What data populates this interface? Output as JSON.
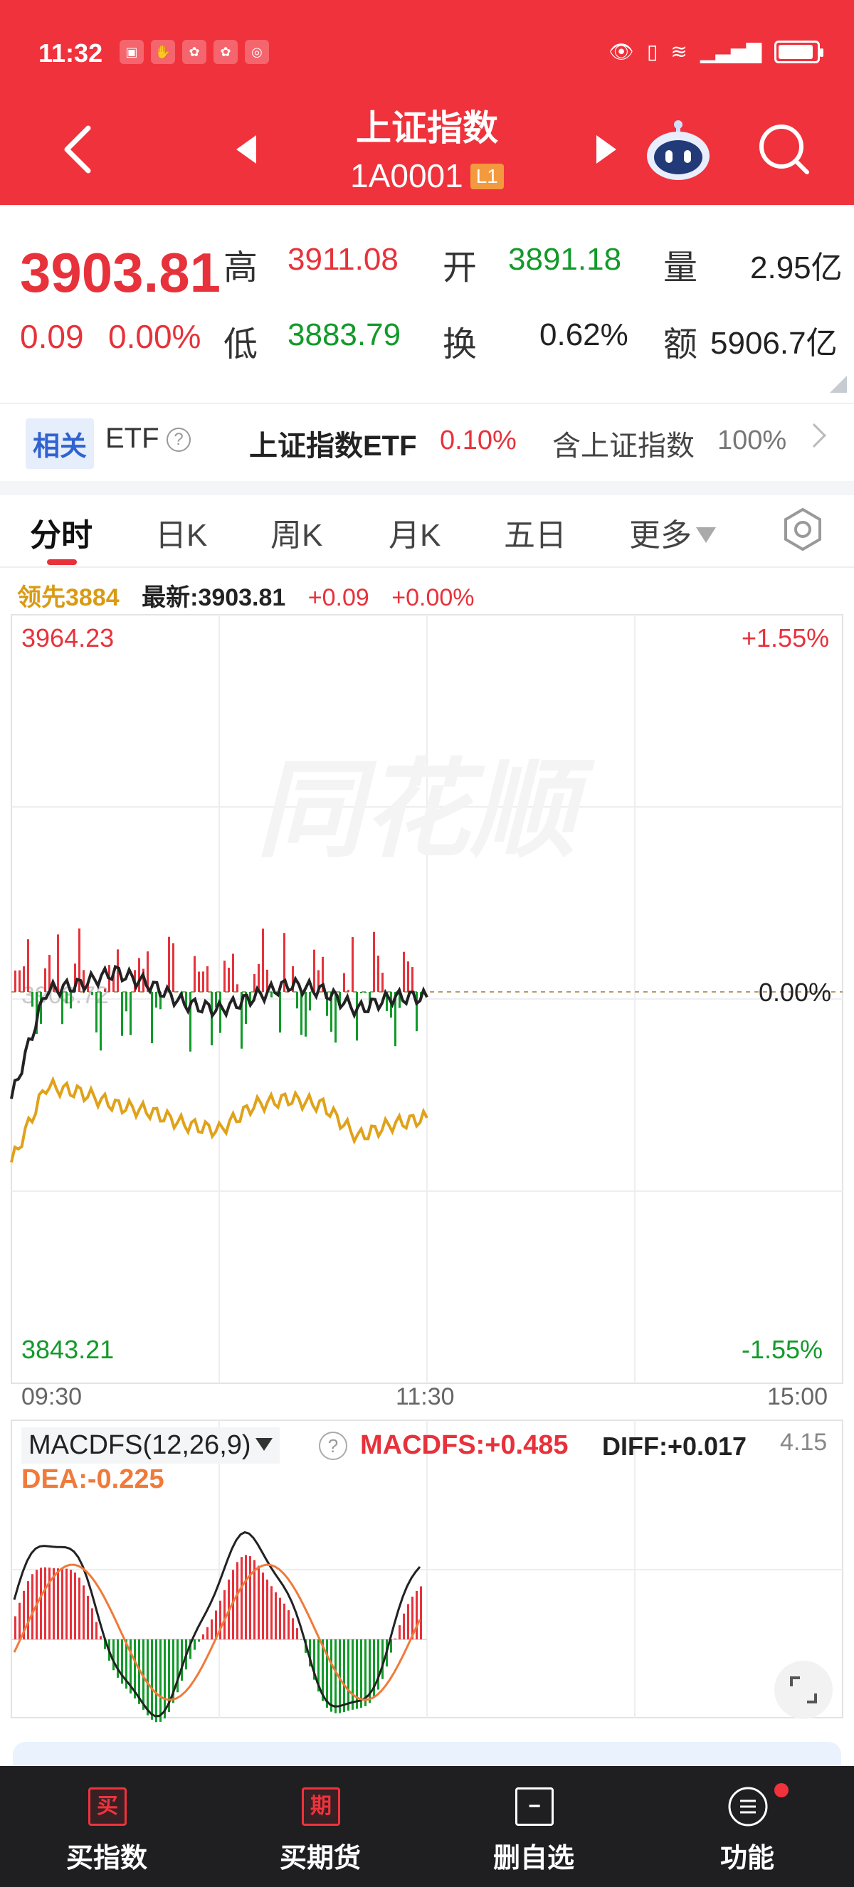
{
  "status_bar": {
    "time": "11:32"
  },
  "header": {
    "title": "上证指数",
    "code": "1A0001",
    "badge": "L1"
  },
  "quote": {
    "price": "3903.81",
    "change_abs": "0.09",
    "change_pct": "0.00%",
    "high_label": "高",
    "high": "3911.08",
    "low_label": "低",
    "low": "3883.79",
    "open_label": "开",
    "open": "3891.18",
    "turnover_label": "换",
    "turnover": "0.62%",
    "volume_label": "量",
    "volume": "2.95亿",
    "amount_label": "额",
    "amount": "5906.7亿"
  },
  "etf": {
    "tag": "相关",
    "label": "ETF",
    "help": "?",
    "name": "上证指数ETF",
    "pct": "0.10%",
    "contains_label": "含上证指数",
    "weight": "100%"
  },
  "tabs": [
    {
      "label": "分时"
    },
    {
      "label": "日K"
    },
    {
      "label": "周K"
    },
    {
      "label": "月K"
    },
    {
      "label": "五日"
    },
    {
      "label": "更多"
    }
  ],
  "info": {
    "lead_label": "领先3884",
    "latest": "最新:3903.81",
    "change_abs": "+0.09",
    "change_pct": "+0.00%"
  },
  "chart": {
    "y_max": "3964.23",
    "y_min": "3843.21",
    "pct_max": "+1.55%",
    "pct_mid": "0.00%",
    "pct_min": "-1.55%",
    "prev_close_faint": "3903.72",
    "watermark": "同花顺",
    "times": [
      "09:30",
      "11:30",
      "15:00"
    ]
  },
  "chart_data": {
    "type": "line",
    "x": [
      "09:30",
      "09:40",
      "09:50",
      "10:00",
      "10:10",
      "10:20",
      "10:30",
      "10:40",
      "10:50",
      "11:00",
      "11:10",
      "11:20",
      "11:30"
    ],
    "series": [
      {
        "values": [
          3888,
          3905,
          3906,
          3908,
          3906,
          3903,
          3902,
          3904,
          3906,
          3905,
          3902,
          3904,
          3904
        ]
      },
      {
        "values": [
          3878,
          3890,
          3889,
          3887,
          3886,
          3884,
          3883,
          3887,
          3888,
          3887,
          3882,
          3884,
          3885
        ]
      }
    ],
    "ylim": [
      3843.21,
      3964.23
    ],
    "colors": {
      "price": "#222222",
      "lead": "#e0a21a",
      "up": "#e7323b",
      "down": "#129a2a"
    }
  },
  "macd": {
    "title": "MACDFS(12,26,9)",
    "help": "?",
    "macdfs": "MACDFS:+0.485",
    "diff": "DIFF:+0.017",
    "dea": "DEA:-0.225",
    "top_value": "4.15"
  },
  "bottom_bar": [
    {
      "icon_text": "买",
      "label": "买指数"
    },
    {
      "icon_text": "期",
      "label": "买期货"
    },
    {
      "icon_text": "",
      "label": "删自选"
    },
    {
      "icon_text": "",
      "label": "功能"
    }
  ],
  "colors": {
    "header_red": "#f0323c",
    "up_red": "#e7323b",
    "down_green": "#129a2a",
    "lead_gold": "#d99a14",
    "dea_orange": "#f07a3a"
  }
}
